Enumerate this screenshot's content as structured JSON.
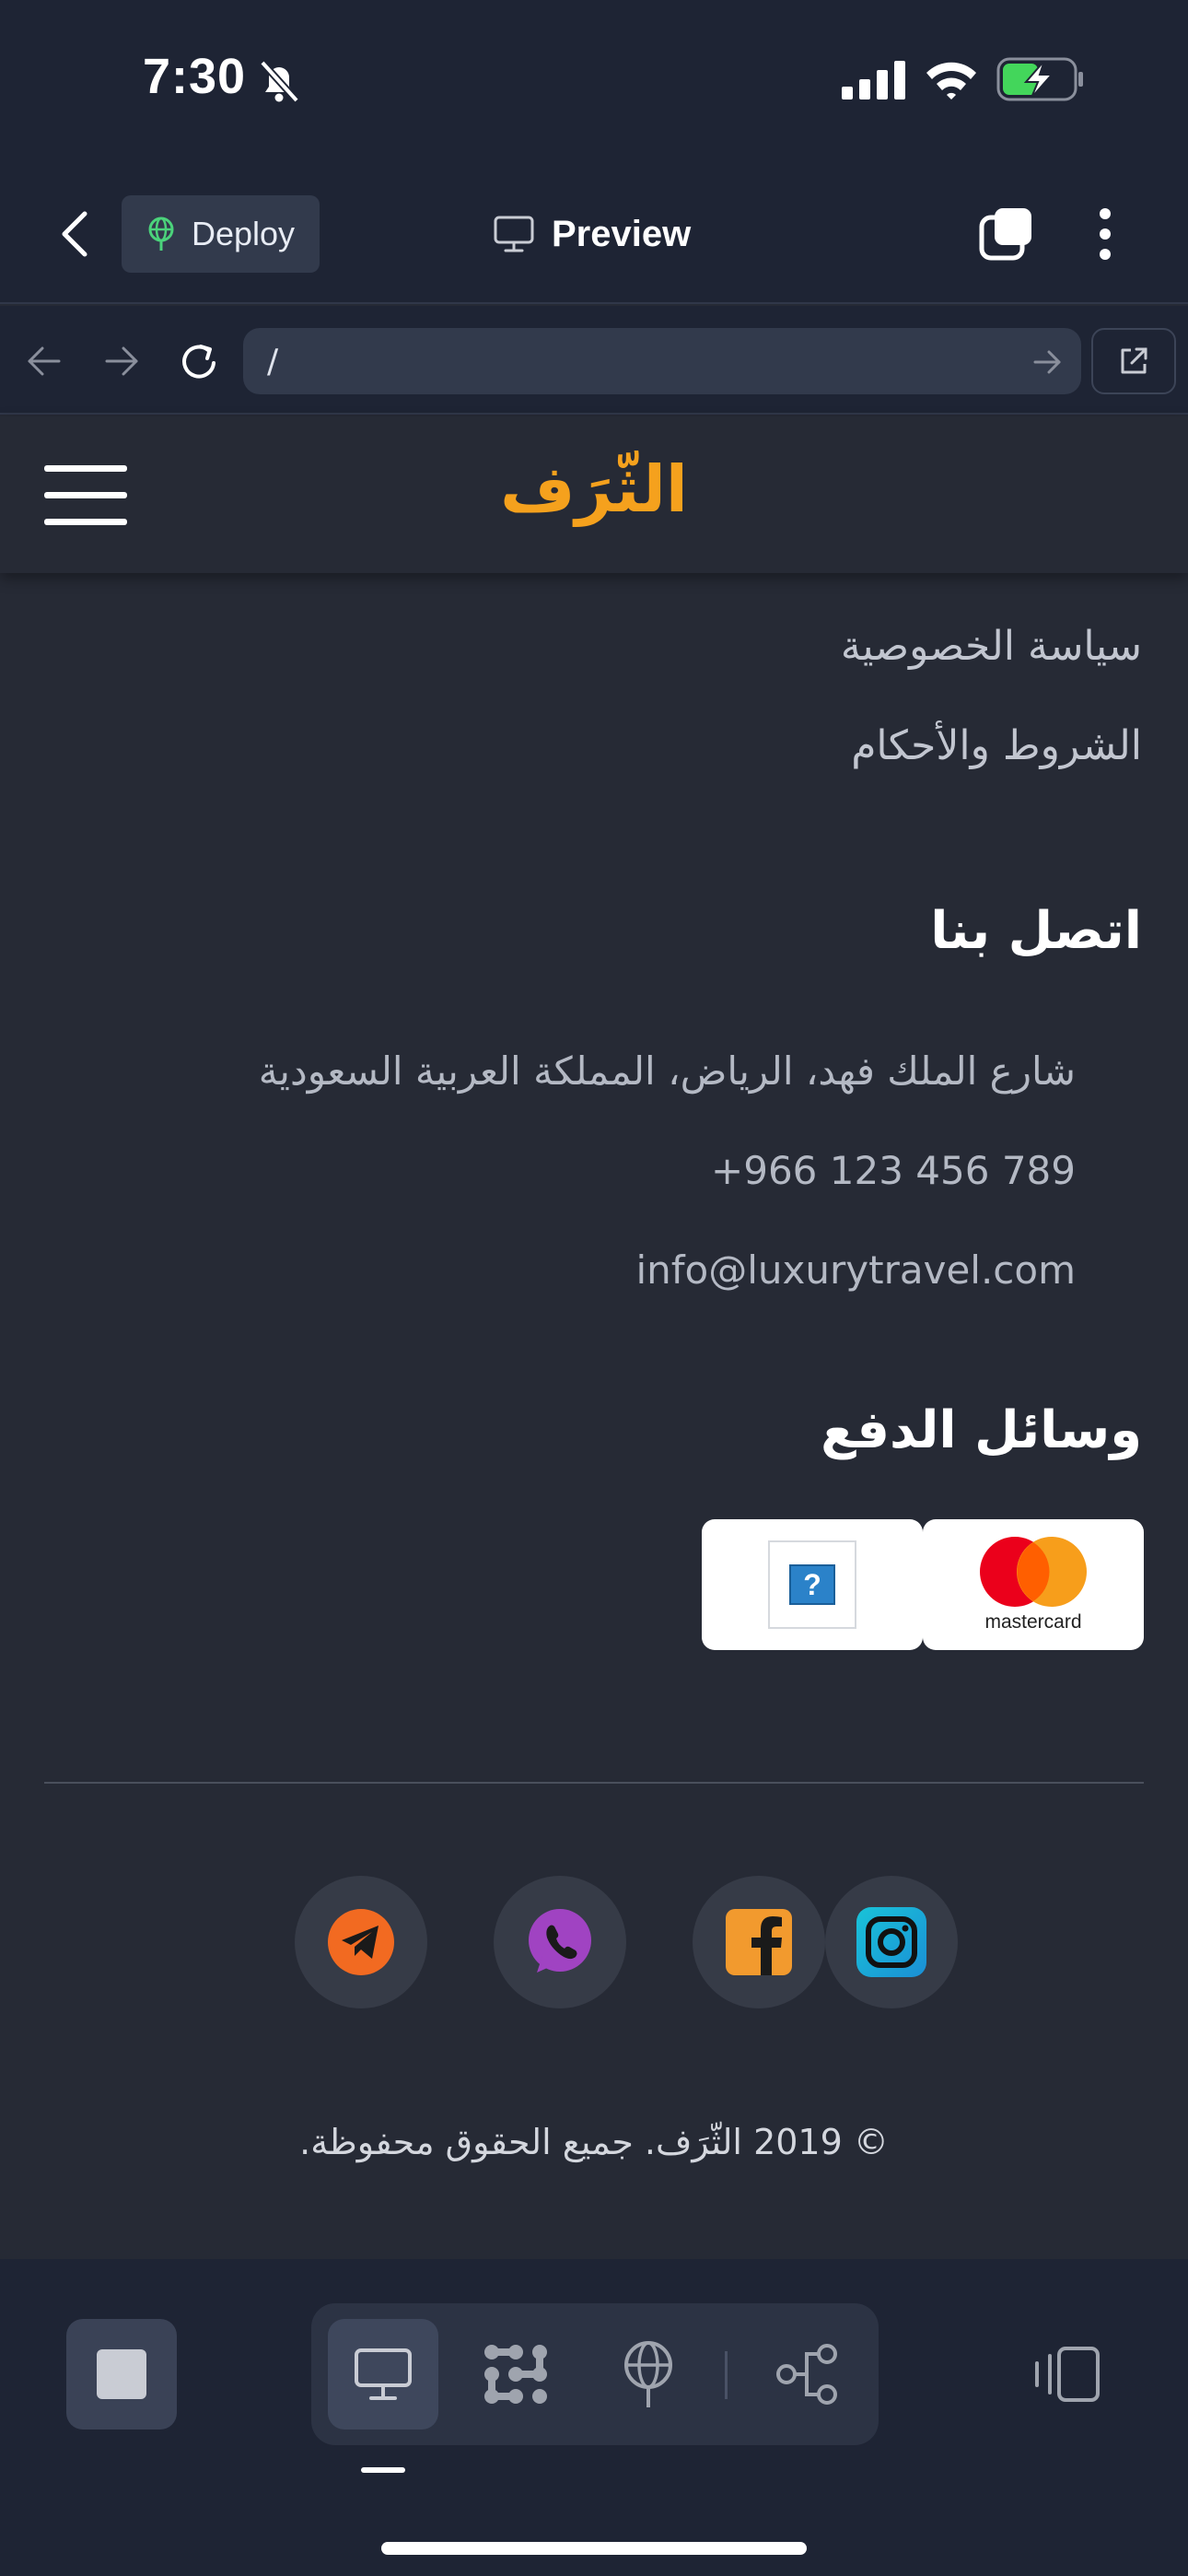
{
  "status_bar": {
    "time": "7:30"
  },
  "app_header": {
    "deploy_label": "Deploy",
    "preview_label": "Preview"
  },
  "url_bar": {
    "url": "/"
  },
  "site": {
    "logo": "الثّرَف",
    "links": [
      "سياسة الخصوصية",
      "الشروط والأحكام"
    ],
    "contact": {
      "heading": "اتصل بنا",
      "address": "شارع الملك فهد، الرياض، المملكة العربية السعودية",
      "phone": "789 456 123 966+",
      "email": "info@luxurytravel.com"
    },
    "payment": {
      "heading": "وسائل الدفع",
      "mastercard_label": "mastercard",
      "broken_image_glyph": "?"
    },
    "social": [
      "telegram-icon",
      "whatsapp-icon",
      "facebook-icon",
      "instagram-icon"
    ],
    "copyright": "© 2019 الثّرَف. جميع الحقوق محفوظة."
  },
  "colors": {
    "accent": "#f5a11d",
    "page_bg": "#262a35",
    "chrome_bg": "#1e2434",
    "battery_green": "#43d65b",
    "telegram": "#f26a21",
    "whatsapp": "#a043c2",
    "facebook": "#f29a2e"
  }
}
